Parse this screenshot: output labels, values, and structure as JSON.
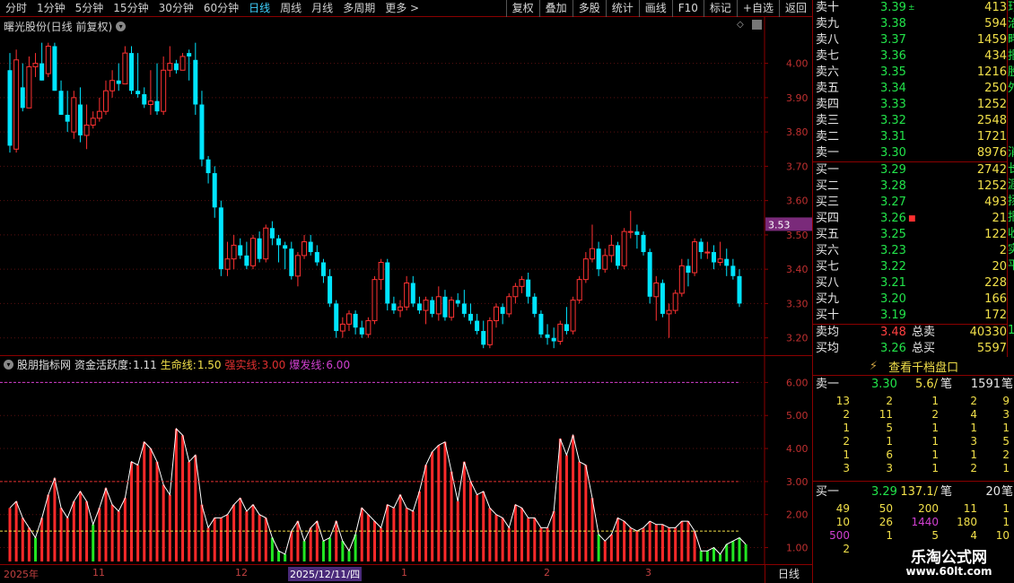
{
  "toolbar": {
    "periods": [
      "分时",
      "1分钟",
      "5分钟",
      "15分钟",
      "30分钟",
      "60分钟",
      "日线",
      "周线",
      "月线",
      "多周期",
      "更多 >"
    ],
    "active": "日线",
    "buttons": [
      "复权",
      "叠加",
      "多股",
      "统计",
      "画线",
      "F10",
      "标记",
      "+自选",
      "返回"
    ]
  },
  "main_chart": {
    "title": "曙光股份(日线 前复权)",
    "current_price_tag": "3.53",
    "price_ticks": [
      "4.00",
      "3.90",
      "3.80",
      "3.70",
      "3.60",
      "3.50",
      "3.40",
      "3.30",
      "3.20"
    ]
  },
  "indicator": {
    "name": "股朋指标网",
    "items": [
      {
        "label": "资金活跃度:",
        "value": "1.11",
        "color": "#e0e0e0"
      },
      {
        "label": "生命线:",
        "value": "1.50",
        "color": "#f2e04a"
      },
      {
        "label": "强实线:",
        "value": "3.00",
        "color": "#e03030"
      },
      {
        "label": "爆发线:",
        "value": "6.00",
        "color": "#d040d0"
      }
    ],
    "ticks": [
      "6.00",
      "5.00",
      "4.00",
      "3.00",
      "2.00",
      "1.00"
    ]
  },
  "chart_data": {
    "type": "candlestick",
    "price_range": [
      3.16,
      4.08
    ],
    "indicator_range": [
      0.58,
      6.5
    ],
    "reference_lines": [
      1.5,
      3.0,
      6.0
    ],
    "candles": [
      [
        3.98,
        4.03,
        3.74,
        3.76
      ],
      [
        3.75,
        4.04,
        3.74,
        4.01
      ],
      [
        3.93,
        4.0,
        3.86,
        3.87
      ],
      [
        3.87,
        4.02,
        3.87,
        3.99
      ],
      [
        3.99,
        4.03,
        3.96,
        4.0
      ],
      [
        4.0,
        4.06,
        3.95,
        3.95
      ],
      [
        3.97,
        4.06,
        3.96,
        4.05
      ],
      [
        4.05,
        4.06,
        3.92,
        3.92
      ],
      [
        3.92,
        3.95,
        3.85,
        3.85
      ],
      [
        3.85,
        3.92,
        3.8,
        3.83
      ],
      [
        3.8,
        3.92,
        3.78,
        3.9
      ],
      [
        3.88,
        3.93,
        3.77,
        3.79
      ],
      [
        3.79,
        3.88,
        3.75,
        3.82
      ],
      [
        3.82,
        3.86,
        3.81,
        3.84
      ],
      [
        3.84,
        3.9,
        3.83,
        3.86
      ],
      [
        3.86,
        3.95,
        3.85,
        3.92
      ],
      [
        3.92,
        3.98,
        3.9,
        3.95
      ],
      [
        3.95,
        4.0,
        3.92,
        3.94
      ],
      [
        3.94,
        4.05,
        3.94,
        4.03
      ],
      [
        4.03,
        4.05,
        3.91,
        3.92
      ],
      [
        3.92,
        4.03,
        3.9,
        3.91
      ],
      [
        3.91,
        3.93,
        3.87,
        3.88
      ],
      [
        3.88,
        3.98,
        3.85,
        3.89
      ],
      [
        3.89,
        4.0,
        3.85,
        3.86
      ],
      [
        3.86,
        4.02,
        3.85,
        3.98
      ],
      [
        3.98,
        4.05,
        3.96,
        4.0
      ],
      [
        4.0,
        4.01,
        3.97,
        3.98
      ],
      [
        3.98,
        4.03,
        3.98,
        4.02
      ],
      [
        4.03,
        4.04,
        3.95,
        4.02
      ],
      [
        4.01,
        4.06,
        3.85,
        3.88
      ],
      [
        3.88,
        3.92,
        3.7,
        3.72
      ],
      [
        3.72,
        3.73,
        3.65,
        3.68
      ],
      [
        3.68,
        3.7,
        3.55,
        3.58
      ],
      [
        3.58,
        3.6,
        3.38,
        3.4
      ],
      [
        3.4,
        3.48,
        3.38,
        3.43
      ],
      [
        3.43,
        3.5,
        3.4,
        3.47
      ],
      [
        3.47,
        3.49,
        3.43,
        3.44
      ],
      [
        3.44,
        3.48,
        3.4,
        3.41
      ],
      [
        3.41,
        3.5,
        3.4,
        3.49
      ],
      [
        3.49,
        3.51,
        3.42,
        3.43
      ],
      [
        3.43,
        3.53,
        3.42,
        3.52
      ],
      [
        3.52,
        3.54,
        3.47,
        3.49
      ],
      [
        3.49,
        3.5,
        3.42,
        3.47
      ],
      [
        3.47,
        3.48,
        3.4,
        3.46
      ],
      [
        3.46,
        3.48,
        3.37,
        3.38
      ],
      [
        3.38,
        3.45,
        3.35,
        3.44
      ],
      [
        3.44,
        3.5,
        3.43,
        3.48
      ],
      [
        3.48,
        3.5,
        3.44,
        3.45
      ],
      [
        3.45,
        3.47,
        3.41,
        3.42
      ],
      [
        3.42,
        3.43,
        3.36,
        3.38
      ],
      [
        3.38,
        3.4,
        3.29,
        3.3
      ],
      [
        3.3,
        3.31,
        3.2,
        3.22
      ],
      [
        3.22,
        3.26,
        3.2,
        3.24
      ],
      [
        3.24,
        3.28,
        3.22,
        3.27
      ],
      [
        3.27,
        3.28,
        3.21,
        3.23
      ],
      [
        3.23,
        3.25,
        3.2,
        3.21
      ],
      [
        3.21,
        3.26,
        3.2,
        3.25
      ],
      [
        3.25,
        3.38,
        3.24,
        3.37
      ],
      [
        3.37,
        3.43,
        3.34,
        3.42
      ],
      [
        3.42,
        3.43,
        3.28,
        3.3
      ],
      [
        3.3,
        3.32,
        3.27,
        3.28
      ],
      [
        3.28,
        3.31,
        3.26,
        3.29
      ],
      [
        3.29,
        3.38,
        3.28,
        3.36
      ],
      [
        3.36,
        3.38,
        3.29,
        3.3
      ],
      [
        3.3,
        3.32,
        3.27,
        3.28
      ],
      [
        3.28,
        3.32,
        3.24,
        3.31
      ],
      [
        3.31,
        3.32,
        3.26,
        3.27
      ],
      [
        3.27,
        3.35,
        3.25,
        3.32
      ],
      [
        3.32,
        3.34,
        3.25,
        3.26
      ],
      [
        3.26,
        3.32,
        3.25,
        3.31
      ],
      [
        3.31,
        3.33,
        3.29,
        3.3
      ],
      [
        3.3,
        3.34,
        3.26,
        3.27
      ],
      [
        3.27,
        3.3,
        3.24,
        3.25
      ],
      [
        3.25,
        3.27,
        3.21,
        3.22
      ],
      [
        3.22,
        3.25,
        3.17,
        3.18
      ],
      [
        3.18,
        3.26,
        3.17,
        3.25
      ],
      [
        3.25,
        3.3,
        3.23,
        3.29
      ],
      [
        3.29,
        3.3,
        3.24,
        3.27
      ],
      [
        3.27,
        3.33,
        3.26,
        3.32
      ],
      [
        3.32,
        3.36,
        3.3,
        3.35
      ],
      [
        3.35,
        3.38,
        3.33,
        3.37
      ],
      [
        3.37,
        3.39,
        3.3,
        3.32
      ],
      [
        3.32,
        3.33,
        3.26,
        3.27
      ],
      [
        3.27,
        3.28,
        3.2,
        3.21
      ],
      [
        3.21,
        3.24,
        3.18,
        3.2
      ],
      [
        3.2,
        3.23,
        3.17,
        3.19
      ],
      [
        3.19,
        3.25,
        3.18,
        3.24
      ],
      [
        3.24,
        3.29,
        3.21,
        3.22
      ],
      [
        3.22,
        3.32,
        3.21,
        3.31
      ],
      [
        3.31,
        3.38,
        3.3,
        3.37
      ],
      [
        3.37,
        3.45,
        3.36,
        3.43
      ],
      [
        3.43,
        3.53,
        3.42,
        3.46
      ],
      [
        3.46,
        3.48,
        3.38,
        3.4
      ],
      [
        3.4,
        3.46,
        3.39,
        3.44
      ],
      [
        3.44,
        3.5,
        3.42,
        3.47
      ],
      [
        3.47,
        3.48,
        3.4,
        3.41
      ],
      [
        3.41,
        3.52,
        3.4,
        3.51
      ],
      [
        3.51,
        3.57,
        3.49,
        3.51
      ],
      [
        3.51,
        3.53,
        3.46,
        3.5
      ],
      [
        3.5,
        3.51,
        3.44,
        3.45
      ],
      [
        3.45,
        3.46,
        3.3,
        3.32
      ],
      [
        3.32,
        3.38,
        3.25,
        3.36
      ],
      [
        3.36,
        3.37,
        3.26,
        3.27
      ],
      [
        3.27,
        3.3,
        3.2,
        3.28
      ],
      [
        3.28,
        3.34,
        3.27,
        3.33
      ],
      [
        3.33,
        3.43,
        3.32,
        3.41
      ],
      [
        3.41,
        3.43,
        3.35,
        3.39
      ],
      [
        3.39,
        3.49,
        3.38,
        3.48
      ],
      [
        3.48,
        3.49,
        3.43,
        3.45
      ],
      [
        3.45,
        3.48,
        3.43,
        3.45
      ],
      [
        3.45,
        3.47,
        3.4,
        3.42
      ],
      [
        3.42,
        3.48,
        3.41,
        3.43
      ],
      [
        3.43,
        3.46,
        3.38,
        3.41
      ],
      [
        3.41,
        3.43,
        3.37,
        3.38
      ],
      [
        3.38,
        3.4,
        3.29,
        3.3
      ]
    ],
    "indicator_values": [
      2.2,
      2.4,
      1.9,
      1.6,
      1.3,
      1.9,
      2.6,
      3.1,
      2.2,
      1.9,
      2.4,
      2.7,
      2.4,
      1.7,
      2.2,
      2.8,
      2.3,
      2.1,
      2.5,
      3.6,
      3.5,
      4.2,
      4.0,
      3.6,
      2.9,
      2.6,
      4.6,
      4.4,
      3.6,
      3.8,
      2.3,
      1.6,
      1.9,
      1.9,
      2.0,
      2.3,
      2.5,
      2.1,
      2.3,
      2.0,
      1.9,
      1.3,
      0.9,
      0.8,
      1.5,
      1.8,
      1.2,
      1.6,
      1.8,
      1.2,
      1.3,
      1.8,
      1.2,
      0.9,
      1.4,
      2.2,
      2.0,
      1.8,
      1.6,
      2.3,
      2.2,
      2.6,
      2.2,
      2.1,
      2.7,
      3.5,
      3.9,
      4.1,
      4.2,
      3.3,
      2.4,
      3.6,
      3.0,
      2.6,
      2.7,
      2.2,
      2.0,
      1.9,
      1.6,
      2.3,
      2.2,
      1.9,
      1.9,
      1.6,
      1.6,
      2.1,
      4.3,
      3.8,
      4.4,
      3.6,
      3.5,
      2.5,
      1.4,
      1.2,
      1.4,
      1.9,
      1.8,
      1.6,
      1.5,
      1.6,
      1.8,
      1.7,
      1.7,
      1.6,
      1.6,
      1.8,
      1.8,
      1.5,
      0.9,
      0.9,
      1.0,
      0.8,
      1.1,
      1.2,
      1.3,
      1.1
    ],
    "indicator_bar_colors": [
      "r",
      "r",
      "r",
      "r",
      "g",
      "r",
      "r",
      "r",
      "r",
      "r",
      "r",
      "r",
      "r",
      "g",
      "r",
      "r",
      "r",
      "r",
      "r",
      "r",
      "r",
      "r",
      "r",
      "r",
      "r",
      "r",
      "r",
      "r",
      "r",
      "r",
      "r",
      "r",
      "r",
      "r",
      "r",
      "r",
      "r",
      "r",
      "r",
      "r",
      "r",
      "g",
      "g",
      "g",
      "r",
      "r",
      "g",
      "r",
      "r",
      "g",
      "g",
      "r",
      "g",
      "g",
      "g",
      "r",
      "r",
      "r",
      "r",
      "r",
      "r",
      "r",
      "r",
      "r",
      "r",
      "r",
      "r",
      "r",
      "r",
      "r",
      "r",
      "r",
      "r",
      "r",
      "r",
      "r",
      "r",
      "r",
      "r",
      "r",
      "r",
      "r",
      "r",
      "r",
      "r",
      "r",
      "r",
      "r",
      "r",
      "r",
      "r",
      "r",
      "g",
      "r",
      "r",
      "r",
      "r",
      "r",
      "r",
      "r",
      "r",
      "r",
      "r",
      "r",
      "r",
      "r",
      "r",
      "r",
      "g",
      "g",
      "g",
      "g",
      "g",
      "g",
      "g",
      "g"
    ]
  },
  "bottom_axis": {
    "ticks": [
      {
        "label": "2025年",
        "highlight": false
      },
      {
        "label": "11",
        "highlight": false
      },
      {
        "label": "12",
        "highlight": false
      },
      {
        "label": "2025/12/11/四",
        "highlight": true
      },
      {
        "label": "1",
        "highlight": false
      },
      {
        "label": "2",
        "highlight": false
      },
      {
        "label": "3",
        "highlight": false
      }
    ],
    "period_label": "日线"
  },
  "order_book": {
    "asks": [
      {
        "label": "卖十",
        "price": "3.39",
        "vol": "413",
        "mark": "±"
      },
      {
        "label": "卖九",
        "price": "3.38",
        "vol": "594",
        "mark": ""
      },
      {
        "label": "卖八",
        "price": "3.37",
        "vol": "1459",
        "mark": ""
      },
      {
        "label": "卖七",
        "price": "3.36",
        "vol": "434",
        "mark": ""
      },
      {
        "label": "卖六",
        "price": "3.35",
        "vol": "1216",
        "mark": ""
      },
      {
        "label": "卖五",
        "price": "3.34",
        "vol": "250",
        "mark": ""
      },
      {
        "label": "卖四",
        "price": "3.33",
        "vol": "1252",
        "mark": ""
      },
      {
        "label": "卖三",
        "price": "3.32",
        "vol": "2548",
        "mark": ""
      },
      {
        "label": "卖二",
        "price": "3.31",
        "vol": "1721",
        "mark": ""
      },
      {
        "label": "卖一",
        "price": "3.30",
        "vol": "8976",
        "mark": ""
      }
    ],
    "bids": [
      {
        "label": "买一",
        "price": "3.29",
        "vol": "2742",
        "mark": ""
      },
      {
        "label": "买二",
        "price": "3.28",
        "vol": "1252",
        "mark": ""
      },
      {
        "label": "买三",
        "price": "3.27",
        "vol": "493",
        "mark": ""
      },
      {
        "label": "买四",
        "price": "3.26",
        "vol": "21",
        "mark": "■"
      },
      {
        "label": "买五",
        "price": "3.25",
        "vol": "122",
        "mark": ""
      },
      {
        "label": "买六",
        "price": "3.23",
        "vol": "2",
        "mark": ""
      },
      {
        "label": "买七",
        "price": "3.22",
        "vol": "20",
        "mark": ""
      },
      {
        "label": "买八",
        "price": "3.21",
        "vol": "228",
        "mark": ""
      },
      {
        "label": "买九",
        "price": "3.20",
        "vol": "166",
        "mark": ""
      },
      {
        "label": "买十",
        "price": "3.19",
        "vol": "172",
        "mark": ""
      }
    ],
    "summary": [
      {
        "label": "卖均",
        "price": "3.48",
        "price_color": "#ff4040",
        "tlabel": "总卖",
        "vol": "40330"
      },
      {
        "label": "买均",
        "price": "3.26",
        "price_color": "#22e34a",
        "tlabel": "总买",
        "vol": "5597"
      }
    ],
    "side_strip": [
      "玎",
      "治",
      "畔",
      "报",
      "股",
      "外",
      "",
      "",
      "",
      "消",
      "长",
      "涯",
      "扬",
      "报",
      "收",
      "实",
      "平",
      "",
      "",
      "",
      "1"
    ]
  },
  "level2": {
    "header": "查看千档盘口",
    "ask_row": {
      "label": "卖一",
      "price": "3.30",
      "avg": "5.6/",
      "unit": "笔",
      "count": "1591",
      "count_unit": "笔"
    },
    "ask_grid": [
      [
        "13",
        "2",
        "1",
        "2",
        "9"
      ],
      [
        "2",
        "11",
        "2",
        "4",
        "3"
      ],
      [
        "1",
        "5",
        "1",
        "1",
        "1"
      ],
      [
        "2",
        "1",
        "1",
        "3",
        "5"
      ],
      [
        "1",
        "6",
        "1",
        "1",
        "2"
      ],
      [
        "3",
        "3",
        "1",
        "2",
        "1"
      ]
    ],
    "bid_row": {
      "label": "买一",
      "price": "3.29",
      "avg": "137.1/",
      "unit": "笔",
      "count": "20",
      "count_unit": "笔"
    },
    "bid_grid": [
      [
        "49",
        "50",
        "200",
        "11",
        "1"
      ],
      [
        "10",
        "26",
        "1440",
        "180",
        "1"
      ],
      [
        "500",
        "1",
        "5",
        "4",
        "10"
      ],
      [
        "2",
        "",
        "",
        "",
        ""
      ]
    ],
    "bid_grid_highlight": {
      "1.2": "#d040d0",
      "2.0": "#d040d0"
    }
  },
  "watermark": {
    "line1": "乐淘公式网",
    "line2": "www.60lt.com"
  }
}
